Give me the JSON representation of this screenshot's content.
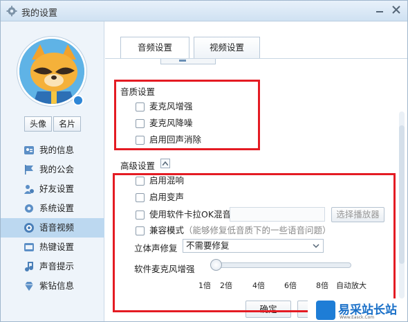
{
  "window": {
    "title": "我的设置"
  },
  "sidebar": {
    "profile_buttons": [
      "头像",
      "名片"
    ],
    "items": [
      {
        "label": "我的信息",
        "icon": "user-card-icon",
        "active": false
      },
      {
        "label": "我的公会",
        "icon": "flag-icon",
        "active": false
      },
      {
        "label": "好友设置",
        "icon": "friends-icon",
        "active": false
      },
      {
        "label": "系统设置",
        "icon": "gear-icon",
        "active": false
      },
      {
        "label": "语音视频",
        "icon": "camera-icon",
        "active": true
      },
      {
        "label": "热键设置",
        "icon": "keyboard-icon",
        "active": false
      },
      {
        "label": "声音提示",
        "icon": "music-note-icon",
        "active": false
      },
      {
        "label": "紫钻信息",
        "icon": "diamond-icon",
        "active": false
      }
    ]
  },
  "tabs": [
    {
      "label": "音频设置",
      "active": true
    },
    {
      "label": "视频设置",
      "active": false
    }
  ],
  "quality": {
    "title": "音质设置",
    "options": [
      {
        "label": "麦克风增强",
        "checked": false
      },
      {
        "label": "麦克风降噪",
        "checked": false
      },
      {
        "label": "启用回声消除",
        "checked": false
      }
    ]
  },
  "advanced": {
    "title": "高级设置",
    "reverb": "启用混响",
    "voice_change": "启用变声",
    "soft_card": "使用软件卡拉OK混音",
    "player_button": "选择播放器",
    "compat_label": "兼容模式",
    "compat_hint": "（能够修复低音质下的一些语音问题）",
    "stereo_label": "立体声修复",
    "stereo_value": "不需要修复",
    "mic_boost_label": "软件麦克风增强",
    "mic_boost_level": 0,
    "ticks": [
      "1倍",
      "2倍",
      "4倍",
      "6倍",
      "8倍",
      "自动放大"
    ]
  },
  "footer": {
    "ok": "确定",
    "cancel": "取"
  },
  "watermark": {
    "text": "易采站长站",
    "sub": "Www.Easck.Com"
  },
  "colors": {
    "highlight_box": "#e41b23",
    "active_item": "#bcd8f0"
  }
}
